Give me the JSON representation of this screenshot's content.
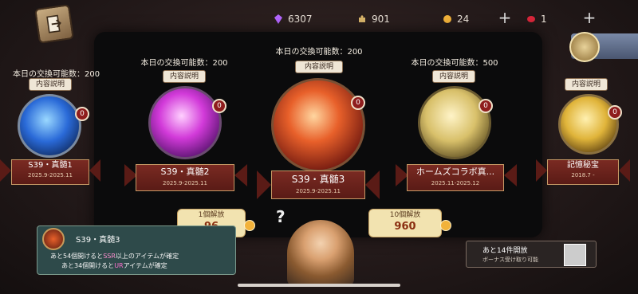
{
  "resources": [
    {
      "icon": "purple-gem-icon",
      "value": "6307",
      "color": "#b366ff"
    },
    {
      "icon": "puzzle-piece-icon",
      "value": "901",
      "color": "#d9b56a"
    },
    {
      "icon": "gold-coin-icon",
      "value": "24",
      "color": "#f2b23a"
    },
    {
      "icon": "red-gem-icon",
      "value": "1",
      "color": "#d8263a"
    }
  ],
  "main_title": "本日の交換可能数：200",
  "desc_label": "内容説明",
  "essences": [
    {
      "limit": "本日の交換可能数：200",
      "badge": "0",
      "name": "S39・真髄1",
      "date": "2025.9-2025.11",
      "color": "#3a8cff"
    },
    {
      "limit": "本日の交換可能数：200",
      "badge": "0",
      "name": "S39・真髄2",
      "date": "2025.9-2025.11",
      "color": "#d93ad9"
    },
    {
      "limit": "本日の交換可能数：200",
      "badge": "0",
      "name": "S39・真髄3",
      "date": "2025.9-2025.11",
      "color": "#e8602a"
    },
    {
      "limit": "本日の交換可能数：500",
      "badge": "0",
      "name": "ホームズコラボ真...",
      "date": "2025.11-2025.12",
      "color": "#d8c06a"
    },
    {
      "limit": "",
      "badge": "0",
      "name": "記憶秘宝",
      "date": "2018.7 -",
      "color": "#e0b43a"
    }
  ],
  "release_single": {
    "label": "1個解放",
    "cost": "96"
  },
  "release_ten": {
    "label": "10個解放",
    "cost": "960"
  },
  "info": {
    "title": "S39・真髄3",
    "line1_a": "あと54個開けると",
    "line1_b": "SSR",
    "line1_c": "以上のアイテムが確定",
    "line2_a": "あと34個開けると",
    "line2_b": "UR",
    "line2_c": "アイテムが確定"
  },
  "bonus": {
    "line1": "あと14件開放",
    "line2": "ボーナス受け取り可能"
  }
}
